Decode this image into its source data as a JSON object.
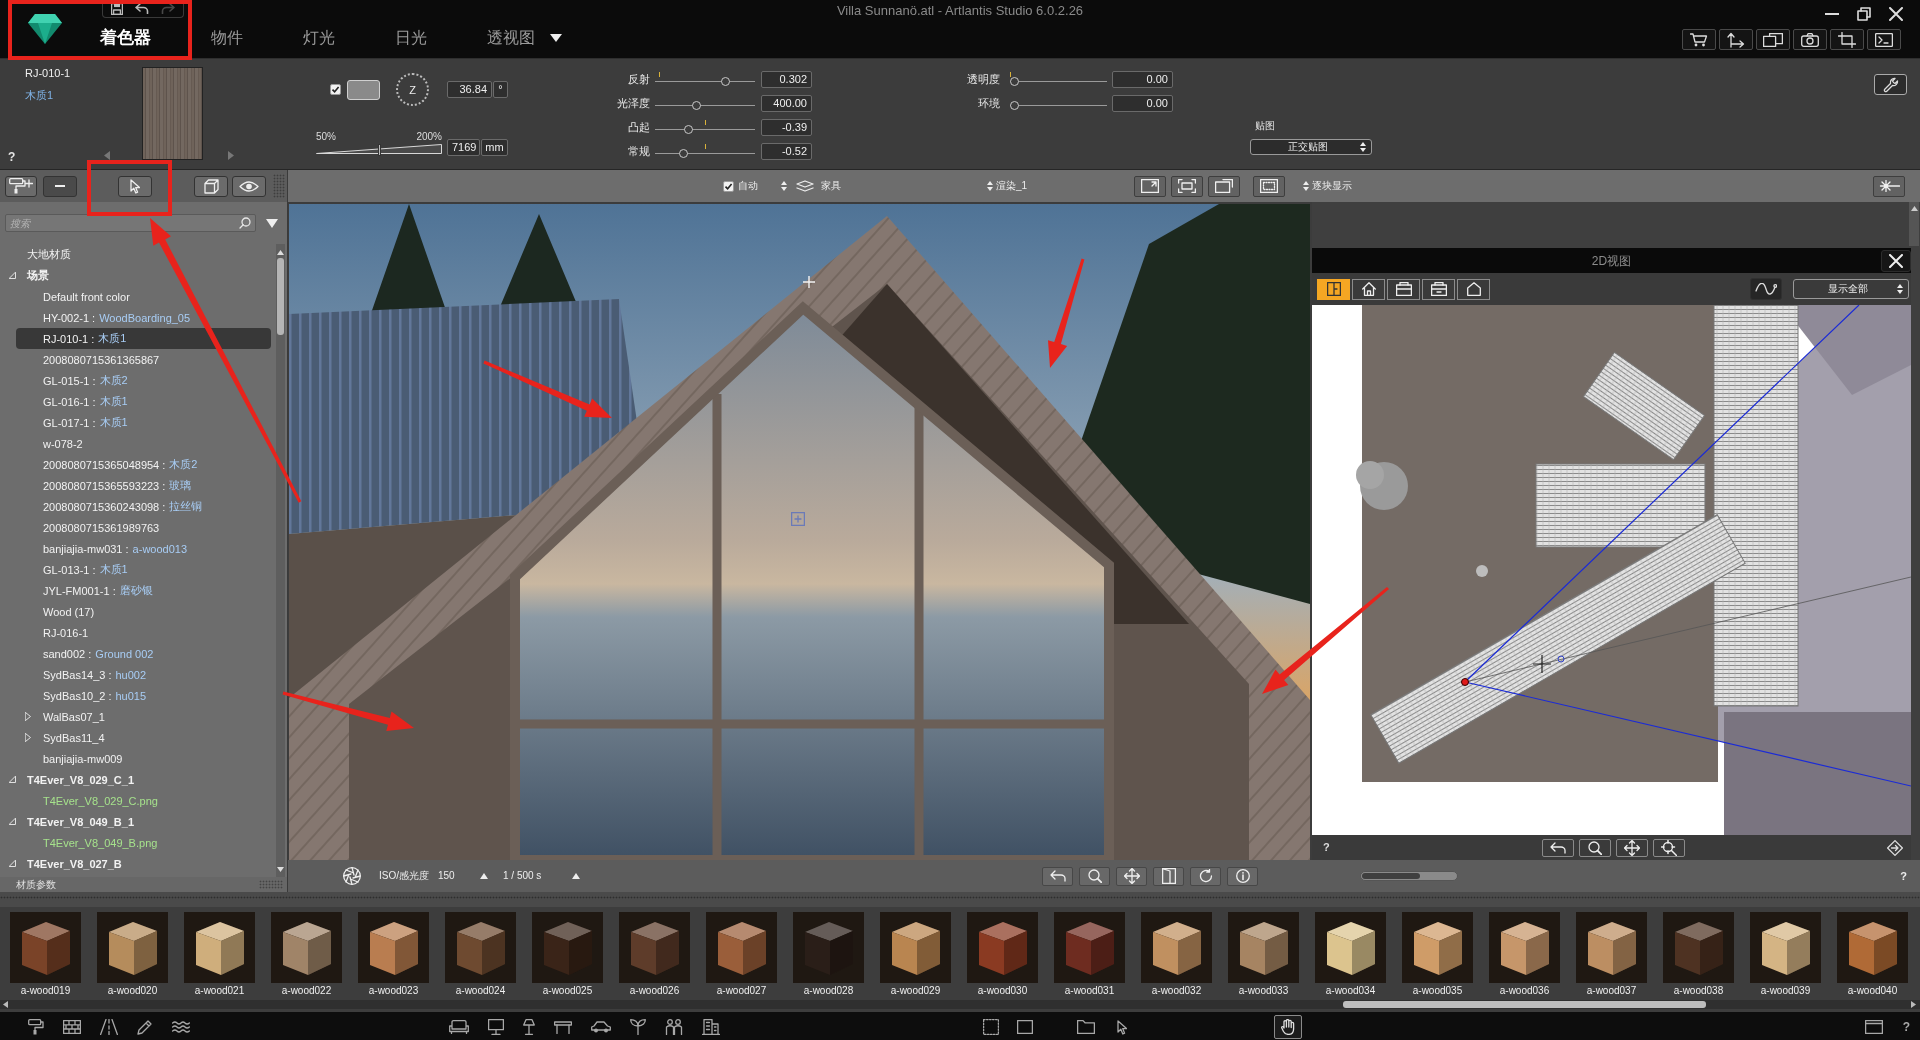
{
  "window": {
    "title": "Villa Sunnanö.atl - Artlantis Studio 6.0.2.26"
  },
  "quick_actions": [
    {
      "kind": "save",
      "disabled": false
    },
    {
      "kind": "undo",
      "disabled": false
    },
    {
      "kind": "redo",
      "disabled": true
    }
  ],
  "tabs": [
    {
      "label": "着色器",
      "selected": true
    },
    {
      "label": "物件",
      "selected": false
    },
    {
      "label": "灯光",
      "selected": false
    },
    {
      "label": "日光",
      "selected": false
    },
    {
      "label": "透视图",
      "selected": false
    }
  ],
  "shader": {
    "name": "RJ-010-1",
    "material": "木质1",
    "help": "?",
    "enabled": true,
    "dial_label": "Z",
    "angle": "36.84",
    "angle_unit": "°",
    "scale_min": "50%",
    "scale_max": "200%",
    "scale": {
      "level": 0.5
    },
    "size": "7169",
    "size_unit": "mm"
  },
  "sliders": [
    {
      "label": "反射",
      "level": 0.72,
      "marker": {
        "level": 0.04
      },
      "value": "0.302"
    },
    {
      "label": "光泽度",
      "level": 0.41,
      "value": "400.00"
    },
    {
      "label": "凸起",
      "level": 0.32,
      "marker": {
        "level": 0.51
      },
      "value": "-0.39"
    },
    {
      "label": "常规",
      "level": 0.26,
      "marker": {
        "level": 0.51
      },
      "value": "-0.52"
    }
  ],
  "sliders_2": [
    {
      "label": "透明度",
      "level": 0,
      "marker": {
        "level": 0
      },
      "value": "0.00"
    },
    {
      "label": "环境",
      "level": 0,
      "value": "0.00"
    }
  ],
  "mapping": {
    "label": "贴图",
    "value": "正交贴图"
  },
  "viewport_toolbar": {
    "auto": {
      "label": "自动",
      "checked": true
    },
    "layer": "家具",
    "render": "渲染_1",
    "display": "逐块显示"
  },
  "search": {
    "placeholder": "搜索"
  },
  "tree": [
    {
      "name": "大地材质",
      "kind": "item",
      "selected": false
    },
    {
      "name": "场景",
      "kind": "group",
      "selected": false,
      "expanded": true,
      "children": [
        {
          "name": "Default front color",
          "kind": "item",
          "selected": false
        },
        {
          "name": "HY-002-1 :",
          "material": "WoodBoarding_05",
          "kind": "item",
          "selected": false
        },
        {
          "name": "RJ-010-1 :",
          "material": "木质1",
          "kind": "item",
          "selected": true
        },
        {
          "name": "2008080715361365867",
          "kind": "item",
          "selected": false
        },
        {
          "name": "GL-015-1 :",
          "material": "木质2",
          "kind": "item",
          "selected": false
        },
        {
          "name": "GL-016-1 :",
          "material": "木质1",
          "kind": "item",
          "selected": false
        },
        {
          "name": "GL-017-1 :",
          "material": "木质1",
          "kind": "item",
          "selected": false
        },
        {
          "name": "w-078-2",
          "kind": "item",
          "selected": false
        },
        {
          "name": "2008080715365048954 :",
          "material": "木质2",
          "kind": "item",
          "selected": false
        },
        {
          "name": "2008080715365593223 :",
          "material": "玻璃",
          "kind": "item",
          "selected": false
        },
        {
          "name": "2008080715360243098 :",
          "material": "拉丝铜",
          "kind": "item",
          "selected": false
        },
        {
          "name": "2008080715361989763",
          "kind": "item",
          "selected": false
        },
        {
          "name": "banjiajia-mw031 :",
          "material": "a-wood013",
          "kind": "item",
          "selected": false
        },
        {
          "name": "GL-013-1 :",
          "material": "木质1",
          "kind": "item",
          "selected": false
        },
        {
          "name": "JYL-FM001-1 :",
          "material": "磨砂银",
          "kind": "item",
          "selected": false
        },
        {
          "name": "Wood (17)",
          "kind": "item",
          "selected": false
        },
        {
          "name": "RJ-016-1",
          "kind": "item",
          "selected": false
        },
        {
          "name": "sand002 :",
          "material": "Ground 002",
          "kind": "item",
          "selected": false
        },
        {
          "name": "SydBas14_3 :",
          "material": "hu002",
          "kind": "item",
          "selected": false
        },
        {
          "name": "SydBas10_2 :",
          "material": "hu015",
          "kind": "item",
          "selected": false
        },
        {
          "name": "WalBas07_1",
          "kind": "item",
          "selected": false,
          "expanded": false
        },
        {
          "name": "SydBas11_4",
          "kind": "item",
          "selected": false,
          "expanded": false
        },
        {
          "name": "banjiajia-mw009",
          "kind": "item",
          "selected": false
        }
      ]
    },
    {
      "name": "T4Ever_V8_029_C_1",
      "kind": "group",
      "selected": false,
      "expanded": true,
      "children": [
        {
          "name": "T4Ever_V8_029_C.png",
          "kind": "texture",
          "selected": false
        }
      ]
    },
    {
      "name": "T4Ever_V8_049_B_1",
      "kind": "group",
      "selected": false,
      "expanded": true,
      "children": [
        {
          "name": "T4Ever_V8_049_B.png",
          "kind": "texture",
          "selected": false
        }
      ]
    },
    {
      "name": "T4Ever_V8_027_B",
      "kind": "group",
      "selected": false,
      "expanded": true
    }
  ],
  "sidebar_footer": "材质参数",
  "camera": {
    "iso_label": "ISO/感光度",
    "iso": "150",
    "shutter": "1 / 500 s"
  },
  "status": {
    "slider": {
      "level": 0.62
    },
    "help": "?"
  },
  "plan": {
    "title": "2D视图",
    "views": [
      {
        "kind": "split",
        "selected": true
      },
      {
        "kind": "house",
        "selected": false
      },
      {
        "kind": "box",
        "selected": false
      },
      {
        "kind": "box_slot",
        "selected": false
      },
      {
        "kind": "gable",
        "selected": false
      }
    ],
    "filter": "显示全部",
    "help": "?"
  },
  "materials": [
    {
      "name": "a-wood019",
      "color": "#7a4328"
    },
    {
      "name": "a-wood020",
      "color": "#b58c5c"
    },
    {
      "name": "a-wood021",
      "color": "#cfae7c"
    },
    {
      "name": "a-wood022",
      "color": "#a08468"
    },
    {
      "name": "a-wood023",
      "color": "#b97d50"
    },
    {
      "name": "a-wood024",
      "color": "#6e4a30"
    },
    {
      "name": "a-wood025",
      "color": "#3a2418"
    },
    {
      "name": "a-wood026",
      "color": "#5e3c2a"
    },
    {
      "name": "a-wood027",
      "color": "#9a5e3a"
    },
    {
      "name": "a-wood028",
      "color": "#2a1e18"
    },
    {
      "name": "a-wood029",
      "color": "#b98550"
    },
    {
      "name": "a-wood030",
      "color": "#8a3a22"
    },
    {
      "name": "a-wood031",
      "color": "#6e2c20"
    },
    {
      "name": "a-wood032",
      "color": "#c09060"
    },
    {
      "name": "a-wood033",
      "color": "#a68462"
    },
    {
      "name": "a-wood034",
      "color": "#dcc48e"
    },
    {
      "name": "a-wood035",
      "color": "#cf9c68"
    },
    {
      "name": "a-wood036",
      "color": "#c6966a"
    },
    {
      "name": "a-wood037",
      "color": "#bc8e62"
    },
    {
      "name": "a-wood038",
      "color": "#4e3222"
    },
    {
      "name": "a-wood039",
      "color": "#d4b484"
    },
    {
      "name": "a-wood040",
      "color": "#b06a36"
    }
  ],
  "bottom_bar": {
    "tools": [
      {
        "kind": "folder",
        "selected": false
      },
      {
        "kind": "pointer",
        "selected": false
      },
      {
        "kind": "hand",
        "selected": true
      }
    ],
    "help": "?"
  }
}
